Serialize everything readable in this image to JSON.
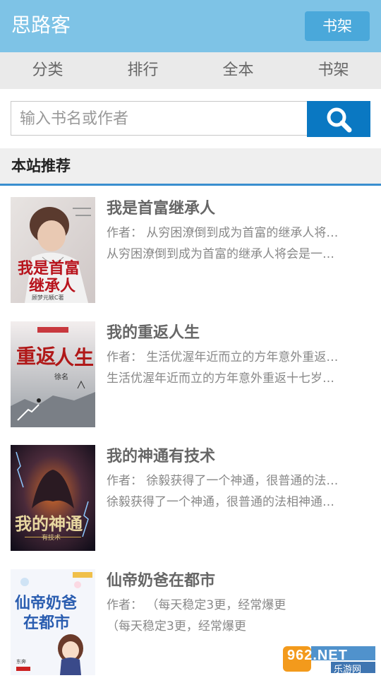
{
  "header": {
    "title": "思路客",
    "shelf_button": "书架"
  },
  "nav": {
    "tabs": [
      "分类",
      "排行",
      "全本",
      "书架"
    ]
  },
  "search": {
    "placeholder": "输入书名或作者",
    "button_icon": "search-icon"
  },
  "section": {
    "title": "本站推荐"
  },
  "books": [
    {
      "title": "我是首富继承人",
      "author_line": "作者：  从穷困潦倒到成为首富的继承人将…",
      "desc": "从穷困潦倒到成为首富的继承人将会是一…",
      "cover_text": [
        "我是首富",
        "继承人"
      ],
      "cover_small": "顾梦元颖C著"
    },
    {
      "title": "我的重返人生",
      "author_line": "作者：  生活优渥年近而立的方年意外重返…",
      "desc": "生活优渥年近而立的方年意外重返十七岁…",
      "cover_text": [
        "重返",
        "人生"
      ],
      "cover_small": "徐名"
    },
    {
      "title": "我的神通有技术",
      "author_line": "作者：  徐毅获得了一个神通，很普通的法…",
      "desc": "徐毅获得了一个神通，很普通的法相神通…",
      "cover_text": [
        "我的神通"
      ],
      "cover_small": "有技术"
    },
    {
      "title": "仙帝奶爸在都市",
      "author_line": "作者：  （每天稳定3更，经常爆更",
      "desc": "（每天稳定3更，经常爆更",
      "cover_text": [
        "仙帝奶爸",
        "在都市"
      ],
      "cover_small": "东奔"
    }
  ],
  "watermark": {
    "brand": "962.NET",
    "sub": "乐游网"
  }
}
